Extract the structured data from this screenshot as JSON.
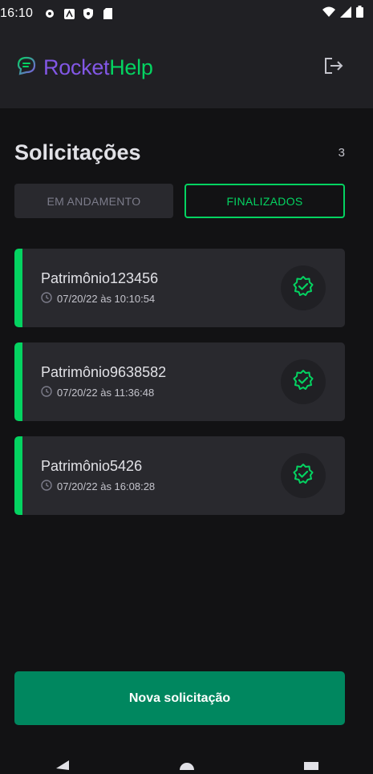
{
  "status_bar": {
    "time": "16:10"
  },
  "header": {
    "brand_part1": "Rocket",
    "brand_part2": "Help"
  },
  "page": {
    "title": "Solicitações",
    "count": "3"
  },
  "filters": {
    "open_label": "EM ANDAMENTO",
    "closed_label": "FINALIZADOS",
    "selected": "closed"
  },
  "orders": [
    {
      "patrimony": "Patrimônio123456",
      "when": "07/20/22 às 10:10:54",
      "status": "closed"
    },
    {
      "patrimony": "Patrimônio9638582",
      "when": "07/20/22 às 11:36:48",
      "status": "closed"
    },
    {
      "patrimony": "Patrimônio5426",
      "when": "07/20/22 às 16:08:28",
      "status": "closed"
    }
  ],
  "actions": {
    "new_request_label": "Nova solicitação"
  },
  "colors": {
    "accent_green": "#04D361",
    "brand_purple": "#8257E5",
    "button_green": "#00875F"
  },
  "icons": [
    "chat-bubble-icon",
    "sign-out-icon",
    "clock-icon",
    "check-seal-icon",
    "back-icon",
    "home-icon",
    "recents-icon"
  ]
}
